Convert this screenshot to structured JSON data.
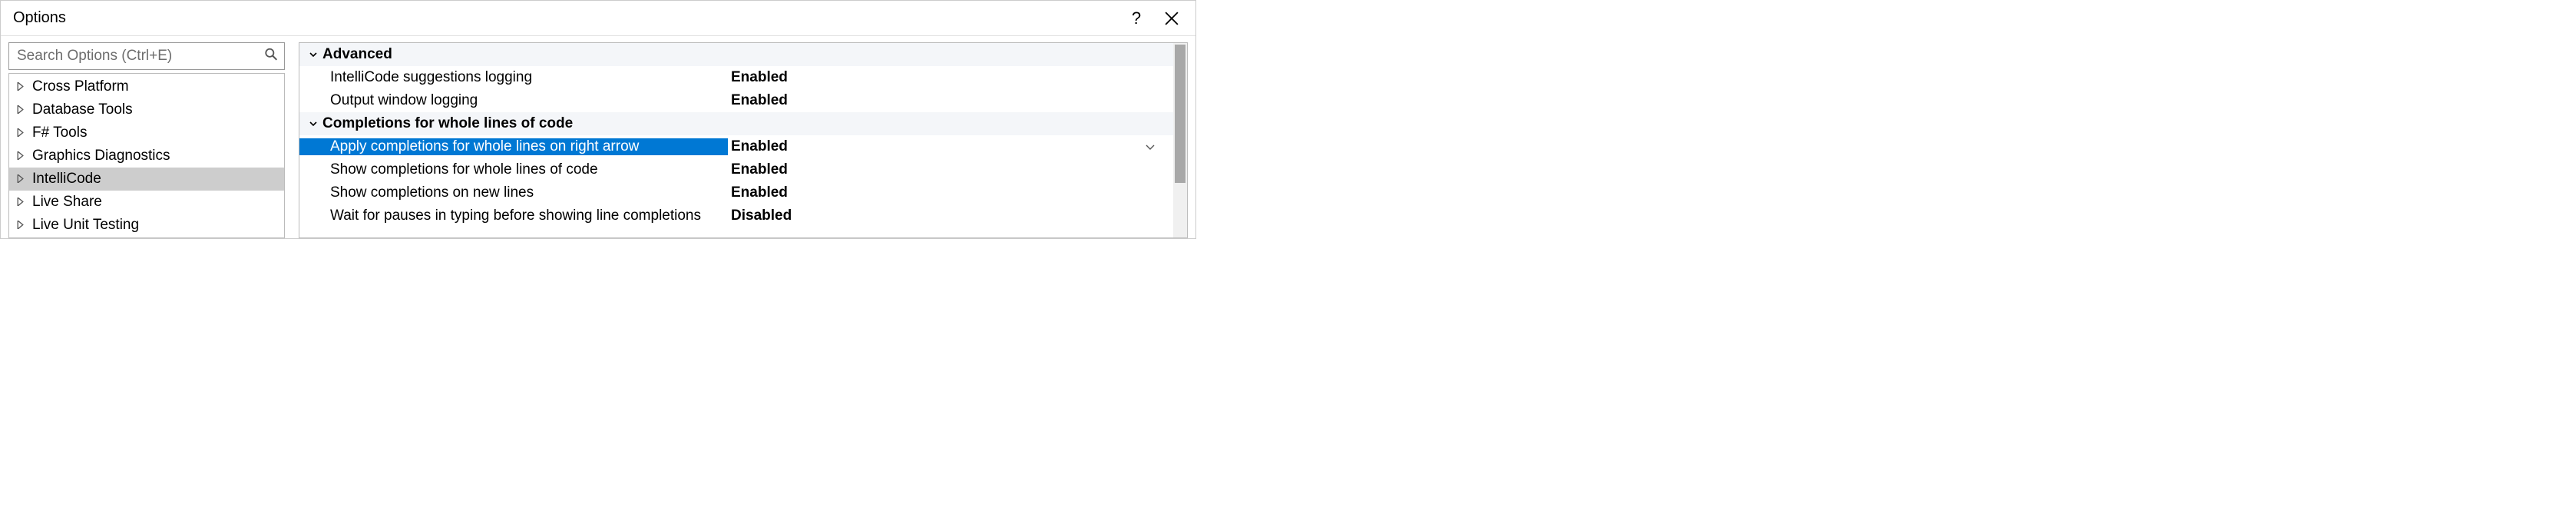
{
  "window": {
    "title": "Options",
    "help_symbol": "?",
    "close_symbol": "×"
  },
  "search": {
    "placeholder": "Search Options (Ctrl+E)"
  },
  "tree": {
    "items": [
      {
        "label": "Cross Platform",
        "selected": false
      },
      {
        "label": "Database Tools",
        "selected": false
      },
      {
        "label": "F# Tools",
        "selected": false
      },
      {
        "label": "Graphics Diagnostics",
        "selected": false
      },
      {
        "label": "IntelliCode",
        "selected": true
      },
      {
        "label": "Live Share",
        "selected": false
      },
      {
        "label": "Live Unit Testing",
        "selected": false
      }
    ]
  },
  "grid": {
    "groups": [
      {
        "header": "Advanced",
        "rows": [
          {
            "label": "IntelliCode suggestions logging",
            "value": "Enabled",
            "selected": false,
            "dropdown": false
          },
          {
            "label": "Output window logging",
            "value": "Enabled",
            "selected": false,
            "dropdown": false
          }
        ]
      },
      {
        "header": "Completions for whole lines of code",
        "rows": [
          {
            "label": "Apply completions for whole lines on right arrow",
            "value": "Enabled",
            "selected": true,
            "dropdown": true
          },
          {
            "label": "Show completions for whole lines of code",
            "value": "Enabled",
            "selected": false,
            "dropdown": false
          },
          {
            "label": "Show completions on new lines",
            "value": "Enabled",
            "selected": false,
            "dropdown": false
          },
          {
            "label": "Wait for pauses in typing before showing line completions",
            "value": "Disabled",
            "selected": false,
            "dropdown": false
          }
        ]
      }
    ]
  }
}
